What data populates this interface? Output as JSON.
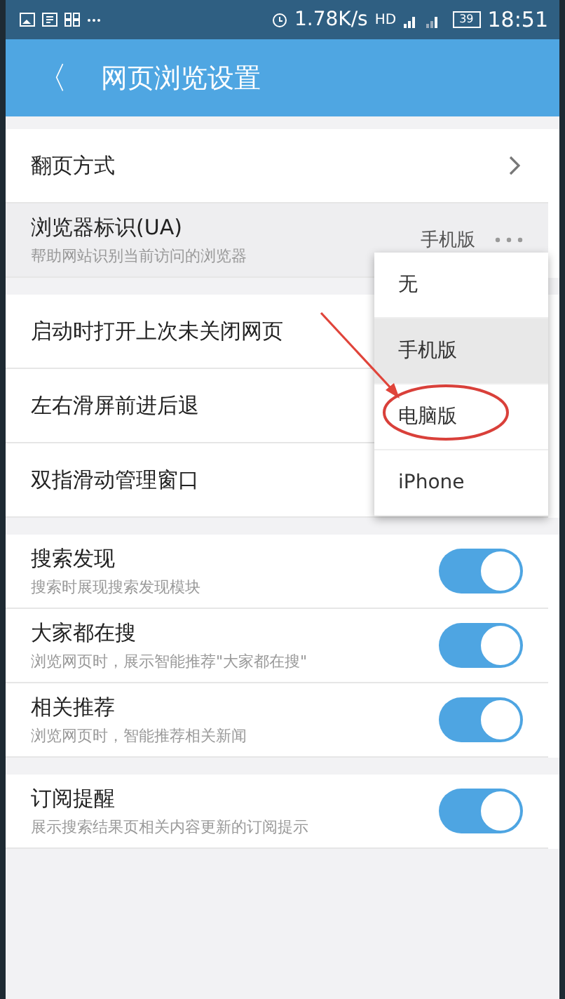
{
  "status_bar": {
    "speed": "1.78K/s",
    "hd": "HD",
    "battery": "39",
    "time": "18:51"
  },
  "title_bar": {
    "back": "〈",
    "title": "网页浏览设置"
  },
  "sections": [
    {
      "items": [
        {
          "kind": "link",
          "title": "翻页方式",
          "highlighted": false
        },
        {
          "kind": "value",
          "title": "浏览器标识(UA)",
          "subtitle": "帮助网站识别当前访问的浏览器",
          "value": "手机版",
          "highlighted": true
        }
      ]
    },
    {
      "items": [
        {
          "kind": "plain",
          "title": "启动时打开上次未关闭网页",
          "highlighted": false
        },
        {
          "kind": "plain",
          "title": "左右滑屏前进后退",
          "highlighted": false
        },
        {
          "kind": "plain",
          "title": "双指滑动管理窗口",
          "highlighted": false
        }
      ]
    },
    {
      "items": [
        {
          "kind": "toggle",
          "title": "搜索发现",
          "subtitle": "搜索时展现搜索发现模块",
          "on": true,
          "highlighted": false
        },
        {
          "kind": "toggle",
          "title": "大家都在搜",
          "subtitle": "浏览网页时，展示智能推荐\"大家都在搜\"",
          "on": true,
          "highlighted": false
        },
        {
          "kind": "toggle",
          "title": "相关推荐",
          "subtitle": "浏览网页时，智能推荐相关新闻",
          "on": true,
          "highlighted": false
        }
      ]
    },
    {
      "items": [
        {
          "kind": "toggle",
          "title": "订阅提醒",
          "subtitle": "展示搜索结果页相关内容更新的订阅提示",
          "on": true,
          "highlighted": false
        }
      ]
    }
  ],
  "menu": {
    "options": [
      {
        "label": "无",
        "selected": false
      },
      {
        "label": "手机版",
        "selected": true
      },
      {
        "label": "电脑版",
        "selected": false
      },
      {
        "label": "iPhone",
        "selected": false
      }
    ]
  }
}
